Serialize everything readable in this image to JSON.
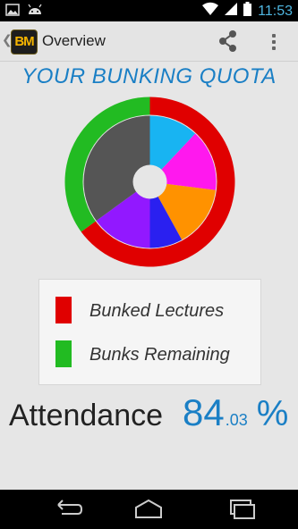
{
  "status_bar": {
    "time": "11:53",
    "left_icons": [
      "image-icon",
      "android-icon"
    ],
    "right_icons": [
      "wifi-icon",
      "signal-icon",
      "battery-icon"
    ]
  },
  "action_bar": {
    "app_icon_text": "BM",
    "title": "Overview",
    "actions": [
      "share-icon",
      "overflow-menu-icon"
    ]
  },
  "main": {
    "title": "YOUR BUNKING QUOTA",
    "legend": [
      {
        "label": "Bunked Lectures",
        "color": "#e00000"
      },
      {
        "label": "Bunks Remaining",
        "color": "#22bb22"
      }
    ],
    "attendance": {
      "label": "Attendance",
      "value_int": "84",
      "value_dec": ".03",
      "unit": "%"
    }
  },
  "chart_data": {
    "type": "pie",
    "outer_ring": {
      "values": [
        0.65,
        0.35
      ],
      "colors": [
        "#e00000",
        "#22bb22"
      ]
    },
    "inner_slices": {
      "values": [
        12,
        15,
        15,
        8,
        15,
        35
      ],
      "colors": [
        "#18b4f2",
        "#ff18ee",
        "#ff9200",
        "#2a20f0",
        "#9218ff",
        "#555555"
      ]
    }
  },
  "nav_bar": {
    "buttons": [
      "back-icon",
      "home-icon",
      "recent-apps-icon"
    ]
  }
}
